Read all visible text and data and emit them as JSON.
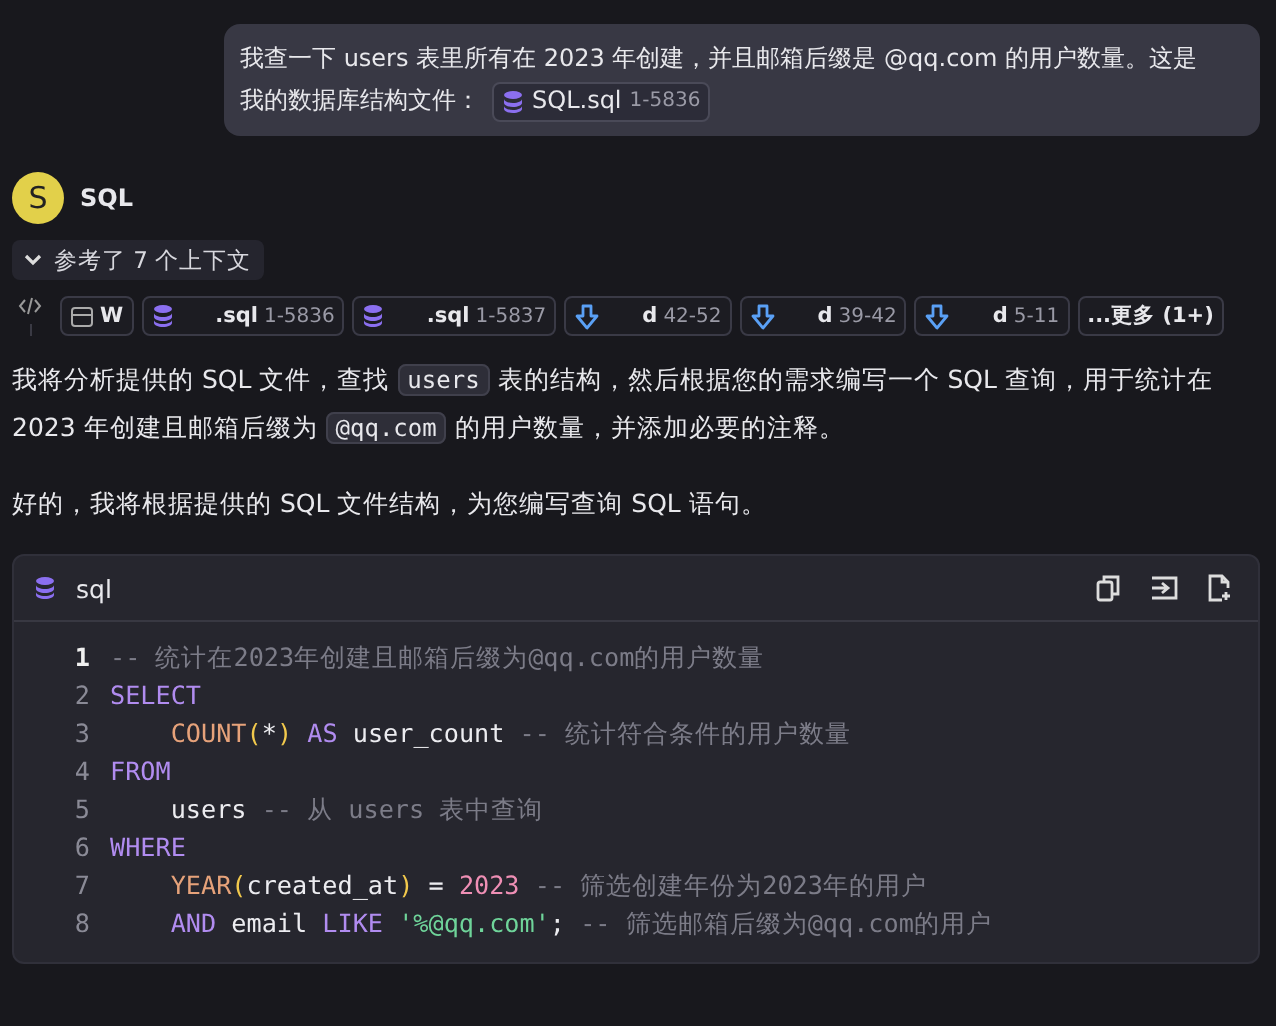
{
  "user_message": {
    "lines": [
      "我查一下 users 表里所有在 2023 年创建，并且邮箱后缀是 @qq.com 的用户数量。这是",
      "我的数据库结构文件："
    ],
    "file": {
      "name": "SQL.sql",
      "range": "1-5836"
    }
  },
  "assistant": {
    "avatar": "S",
    "name": "SQL"
  },
  "context": {
    "label": "参考了 7 个上下文",
    "expanded": true,
    "chips": [
      {
        "kind": "folder",
        "name": "W"
      },
      {
        "kind": "database",
        "name": ".sql",
        "range": "1-5836"
      },
      {
        "kind": "database",
        "name": ".sql",
        "range": "1-5837"
      },
      {
        "kind": "download",
        "name": "d",
        "range": "42-52"
      },
      {
        "kind": "download",
        "name": "d",
        "range": "39-42"
      },
      {
        "kind": "download",
        "name": "d",
        "range": "5-11"
      }
    ],
    "more": "...更多 (1+)"
  },
  "paragraphs": [
    [
      {
        "kind": "text",
        "text": "我将分析提供的 SQL 文件，查找 "
      },
      {
        "kind": "code",
        "text": "users"
      },
      {
        "kind": "text",
        "text": " 表的结构，然后根据您的需求编写一个 SQL 查询，用于统计在 2023 年创建且邮箱后缀为 "
      },
      {
        "kind": "code",
        "text": "@qq.com"
      },
      {
        "kind": "text",
        "text": " 的用户数量，并添加必要的注释。"
      }
    ],
    [
      {
        "kind": "text",
        "text": "好的，我将根据提供的 SQL 文件结构，为您编写查询 SQL 语句。"
      }
    ]
  ],
  "code_block": {
    "language": "sql",
    "lines": [
      {
        "number": "1",
        "current": true,
        "indent": false,
        "tokens": [
          {
            "kind": "comment",
            "text": "-- 统计在2023年创建且邮箱后缀为@qq.com的用户数量"
          }
        ]
      },
      {
        "number": "2",
        "current": false,
        "indent": false,
        "tokens": [
          {
            "kind": "keyword",
            "text": "SELECT"
          }
        ]
      },
      {
        "number": "3",
        "current": false,
        "indent": true,
        "tokens": [
          {
            "kind": "function",
            "text": "COUNT"
          },
          {
            "kind": "paren",
            "text": "("
          },
          {
            "kind": "plain",
            "text": "*"
          },
          {
            "kind": "paren",
            "text": ")"
          },
          {
            "kind": "keyword",
            "text": " AS"
          },
          {
            "kind": "plain",
            "text": " user_count "
          },
          {
            "kind": "comment",
            "text": "-- 统计符合条件的用户数量"
          }
        ]
      },
      {
        "number": "4",
        "current": false,
        "indent": false,
        "tokens": [
          {
            "kind": "keyword",
            "text": "FROM"
          }
        ]
      },
      {
        "number": "5",
        "current": false,
        "indent": true,
        "tokens": [
          {
            "kind": "plain",
            "text": "users "
          },
          {
            "kind": "comment",
            "text": "-- 从 users 表中查询"
          }
        ]
      },
      {
        "number": "6",
        "current": false,
        "indent": false,
        "tokens": [
          {
            "kind": "keyword",
            "text": "WHERE"
          }
        ]
      },
      {
        "number": "7",
        "current": false,
        "indent": true,
        "tokens": [
          {
            "kind": "function",
            "text": "YEAR"
          },
          {
            "kind": "paren",
            "text": "("
          },
          {
            "kind": "plain",
            "text": "created_at"
          },
          {
            "kind": "paren",
            "text": ")"
          },
          {
            "kind": "plain",
            "text": " = "
          },
          {
            "kind": "number",
            "text": "2023"
          },
          {
            "kind": "comment",
            "text": " -- 筛选创建年份为2023年的用户"
          }
        ]
      },
      {
        "number": "8",
        "current": false,
        "indent": true,
        "tokens": [
          {
            "kind": "keyword",
            "text": "AND"
          },
          {
            "kind": "plain",
            "text": " email "
          },
          {
            "kind": "keyword",
            "text": "LIKE"
          },
          {
            "kind": "string",
            "text": " '%@qq.com'"
          },
          {
            "kind": "plain",
            "text": "; "
          },
          {
            "kind": "comment",
            "text": "-- 筛选邮箱后缀为@qq.com的用户"
          }
        ]
      }
    ]
  }
}
